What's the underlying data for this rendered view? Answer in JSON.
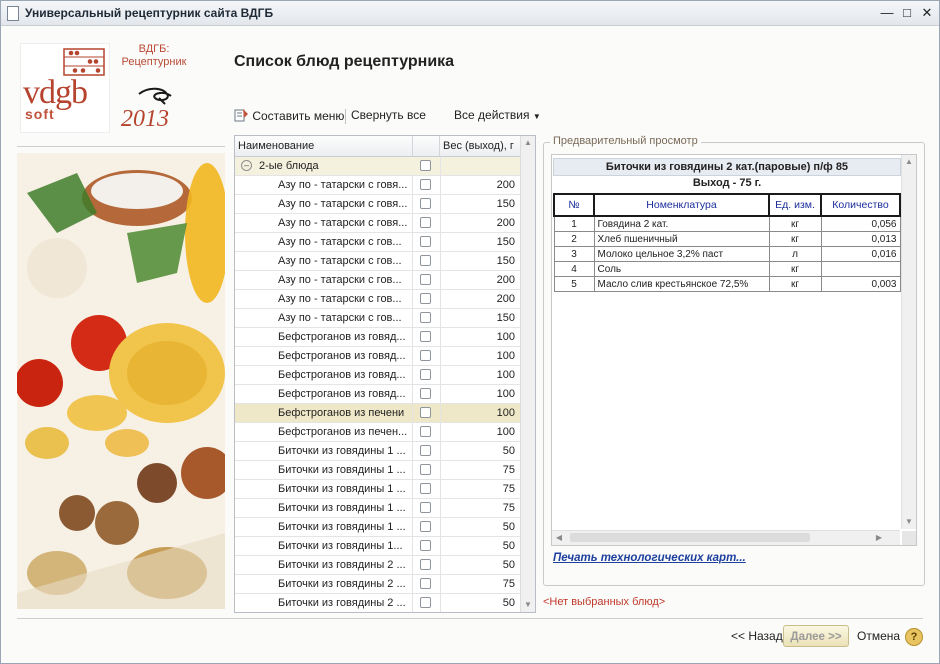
{
  "window": {
    "title": "Универсальный рецептурник сайта ВДГБ"
  },
  "logo": {
    "vdgb": "vdgb",
    "soft": "soft",
    "brand_line1": "ВДГБ:",
    "brand_line2": "Рецептурник",
    "year_text": "2013"
  },
  "page": {
    "title": "Список блюд рецептурника"
  },
  "toolbar": {
    "make_menu": "Составить меню",
    "collapse_all": "Свернуть все",
    "all_actions": "Все действия"
  },
  "grid": {
    "columns": [
      "Наименование",
      "",
      "Вес (выход), г"
    ],
    "group_label": "2-ые блюда",
    "rows": [
      {
        "name": "Азу по - татарски с говя...",
        "weight": "200"
      },
      {
        "name": "Азу по - татарски с говя...",
        "weight": "150"
      },
      {
        "name": "Азу по - татарски с говя...",
        "weight": "200"
      },
      {
        "name": "Азу по - татарски с гов...",
        "weight": "150"
      },
      {
        "name": "Азу по - татарски с гов...",
        "weight": "150"
      },
      {
        "name": "Азу по - татарски с гов...",
        "weight": "200"
      },
      {
        "name": "Азу по - татарски с гов...",
        "weight": "200"
      },
      {
        "name": "Азу по - татарски с гов...",
        "weight": "150"
      },
      {
        "name": "Бефстроганов из говяд...",
        "weight": "100"
      },
      {
        "name": "Бефстроганов из говяд...",
        "weight": "100"
      },
      {
        "name": "Бефстроганов из говяд...",
        "weight": "100"
      },
      {
        "name": "Бефстроганов из говяд...",
        "weight": "100"
      },
      {
        "name": "Бефстроганов из печени",
        "weight": "100",
        "selected": true
      },
      {
        "name": "Бефстроганов из печен...",
        "weight": "100"
      },
      {
        "name": "Биточки из говядины 1 ...",
        "weight": "50"
      },
      {
        "name": "Биточки из говядины 1 ...",
        "weight": "75"
      },
      {
        "name": "Биточки из говядины 1 ...",
        "weight": "75"
      },
      {
        "name": "Биточки из говядины 1 ...",
        "weight": "75"
      },
      {
        "name": "Биточки из говядины 1 ...",
        "weight": "50"
      },
      {
        "name": "Биточки из говядины 1...",
        "weight": "50"
      },
      {
        "name": "Биточки из говядины 2 ...",
        "weight": "50"
      },
      {
        "name": "Биточки из говядины 2 ...",
        "weight": "75"
      },
      {
        "name": "Биточки из говядины 2 ...",
        "weight": "50"
      }
    ]
  },
  "preview": {
    "legend": "Предварительный просмотр",
    "dish_title": "Биточки из говядины 2 кат.(паровые) п/ф 85",
    "output": "Выход - 75 г.",
    "columns": [
      "№",
      "Номенклатура",
      "Ед. изм.",
      "Количество"
    ],
    "rows": [
      {
        "num": "1",
        "name": "Говядина  2 кат.",
        "unit": "кг",
        "qty": "0,056"
      },
      {
        "num": "2",
        "name": "Хлеб пшеничный",
        "unit": "кг",
        "qty": "0,013"
      },
      {
        "num": "3",
        "name": "Молоко цельное 3,2% паст",
        "unit": "л",
        "qty": "0,016"
      },
      {
        "num": "4",
        "name": "Соль",
        "unit": "кг",
        "qty": ""
      },
      {
        "num": "5",
        "name": "Масло слив крестьянское 72,5%",
        "unit": "кг",
        "qty": "0,003"
      }
    ],
    "print_link": "Печать технологических карт..."
  },
  "status": {
    "no_dishes": "<Нет выбранных блюд>"
  },
  "footer": {
    "back": "<< Назад",
    "next": "Далее >>",
    "cancel": "Отмена",
    "help": "?"
  },
  "colors": {
    "accent_red": "#b5432d",
    "link_blue": "#1d3f9e",
    "selected_row": "#efe8c8",
    "group_row": "#f5f1df"
  }
}
